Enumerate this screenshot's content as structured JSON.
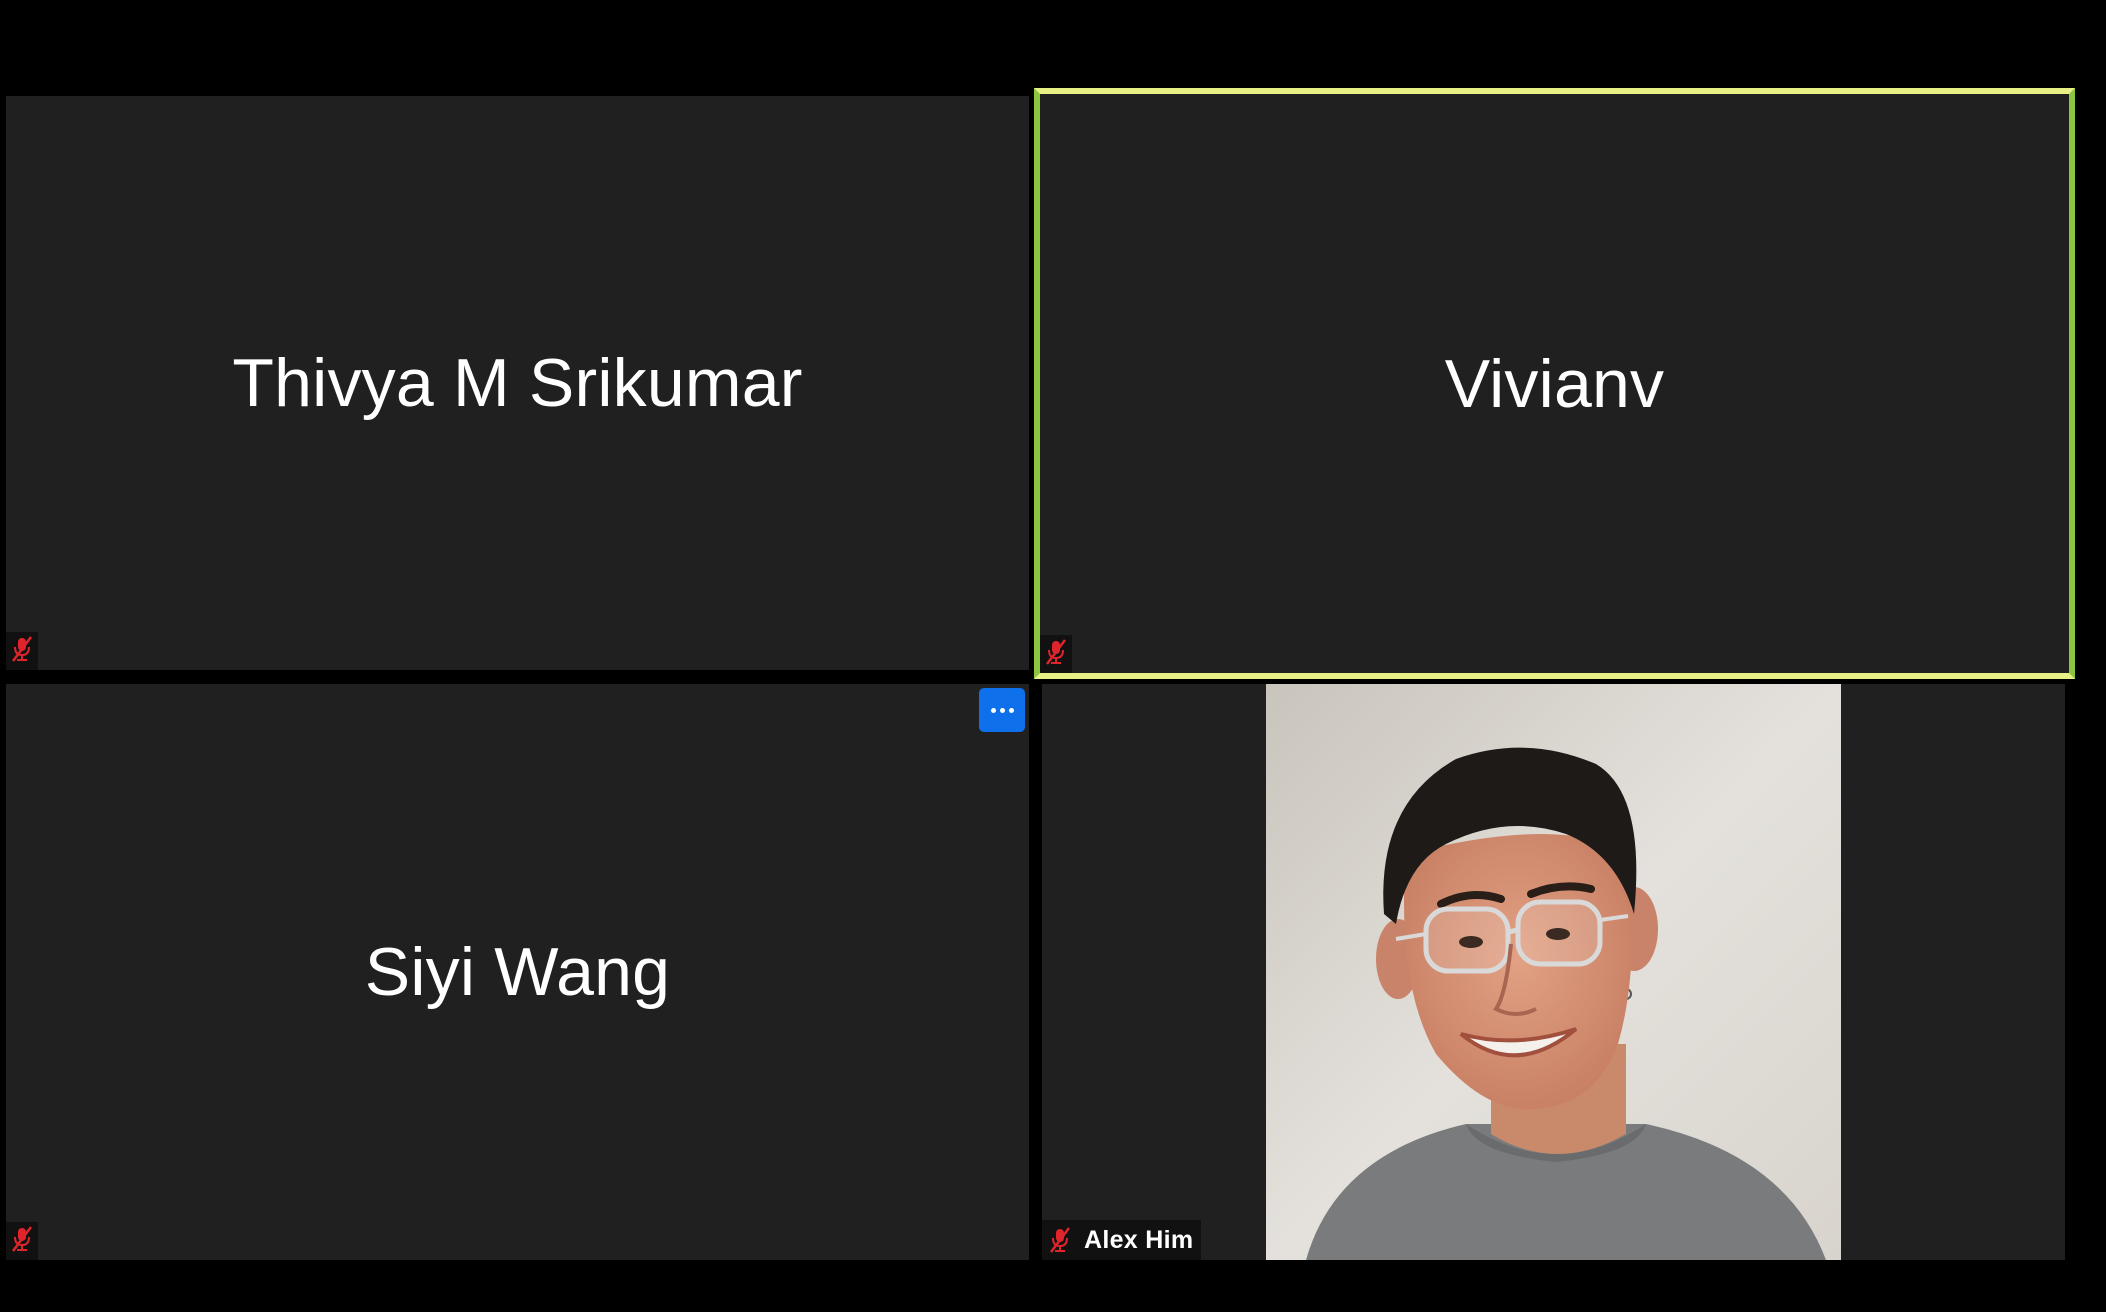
{
  "participants": [
    {
      "name": "Thivya M Srikumar",
      "muted": true,
      "video": false,
      "active_speaker": false
    },
    {
      "name": "Vivianv",
      "muted": true,
      "video": false,
      "active_speaker": true
    },
    {
      "name": "Siyi Wang",
      "muted": true,
      "video": false,
      "active_speaker": false
    },
    {
      "name": "Alex Him",
      "muted": true,
      "video": true,
      "active_speaker": false
    }
  ],
  "icons": {
    "mute": "microphone-muted-icon",
    "more": "more-options-icon"
  },
  "colors": {
    "background": "#000000",
    "tile": "#202020",
    "active_speaker_border": "#e8ef85",
    "muted_icon": "#e0242b",
    "more_button": "#0e71eb"
  }
}
